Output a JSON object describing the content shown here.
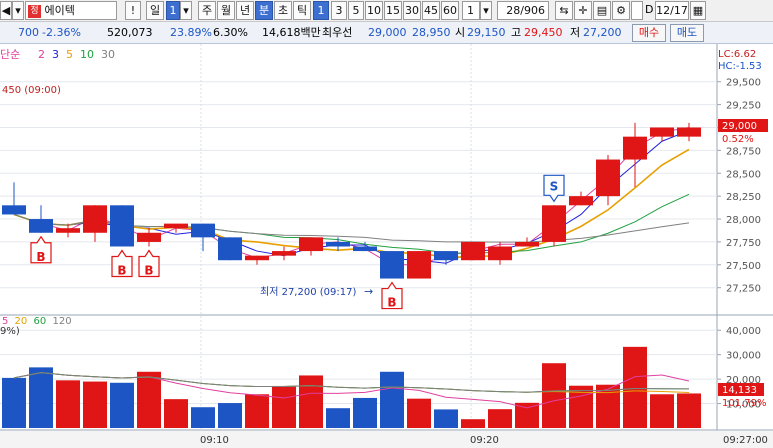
{
  "toolbar": {
    "stock_name": "에이텍",
    "period_buttons": [
      "일",
      "주",
      "월",
      "년",
      "분",
      "초",
      "틱"
    ],
    "active_period": "분",
    "interval_buttons": [
      "1",
      "3",
      "5",
      "10",
      "15",
      "30",
      "45",
      "60"
    ],
    "active_interval": "1",
    "count_value": "1",
    "page_counter": "28/906",
    "checkbox_label": "D",
    "date_value": "12/17"
  },
  "quote": {
    "change": "700",
    "change_pct": "-2.36%",
    "volume": "520,073",
    "turnover_pct": "23.89%",
    "ratio_pct": "6.30%",
    "trade_value": "14,618백만",
    "best_ask_label": "최우선",
    "best_ask": "29,000",
    "best_bid": "28,950",
    "open_label": "시",
    "open": "29,150",
    "high_label": "고",
    "high": "29,450",
    "low_label": "저",
    "low": "27,200",
    "buy_button": "매수",
    "sell_button": "매도"
  },
  "chart_data": {
    "type": "candlestick",
    "ma_legend": {
      "label": "단순",
      "periods": [
        "2",
        "3",
        "5",
        "10",
        "30"
      ],
      "colors": [
        "#e040a0",
        "#2020e0",
        "#e8a000",
        "#20a040",
        "#808080"
      ]
    },
    "volume_ma_legend": {
      "periods": [
        "5",
        "20",
        "60",
        "120"
      ],
      "colors": [
        "#e040a0",
        "#e8a000",
        "#20a040",
        "#808080"
      ]
    },
    "price_axis_ticks": [
      "29,500",
      "29,250",
      "29,000",
      "28,750",
      "28,500",
      "28,250",
      "28,000",
      "27,750",
      "27,500",
      "27,250"
    ],
    "price_range": [
      27050,
      29650
    ],
    "volume_axis_ticks": [
      "40,000",
      "30,000",
      "20,000",
      "10,000"
    ],
    "volume_range": [
      0,
      45000
    ],
    "time_labels": [
      "09:10",
      "09:20",
      "09:27:00"
    ],
    "candles": [
      {
        "o": 28150,
        "h": 28400,
        "l": 28050,
        "c": 28050,
        "v": 20500
      },
      {
        "o": 28000,
        "h": 28150,
        "l": 27850,
        "c": 27850,
        "v": 24800
      },
      {
        "o": 27850,
        "h": 27950,
        "l": 27800,
        "c": 27900,
        "v": 19500
      },
      {
        "o": 27850,
        "h": 28150,
        "l": 27750,
        "c": 28150,
        "v": 19000
      },
      {
        "o": 28150,
        "h": 28150,
        "l": 27700,
        "c": 27700,
        "v": 18500
      },
      {
        "o": 27750,
        "h": 27900,
        "l": 27700,
        "c": 27850,
        "v": 23000
      },
      {
        "o": 27900,
        "h": 27950,
        "l": 27850,
        "c": 27950,
        "v": 11800
      },
      {
        "o": 27950,
        "h": 27950,
        "l": 27650,
        "c": 27800,
        "v": 8500
      },
      {
        "o": 27800,
        "h": 27800,
        "l": 27550,
        "c": 27550,
        "v": 10200
      },
      {
        "o": 27550,
        "h": 27600,
        "l": 27500,
        "c": 27600,
        "v": 13800
      },
      {
        "o": 27600,
        "h": 27700,
        "l": 27550,
        "c": 27650,
        "v": 17200
      },
      {
        "o": 27650,
        "h": 27800,
        "l": 27600,
        "c": 27800,
        "v": 21500
      },
      {
        "o": 27750,
        "h": 27800,
        "l": 27650,
        "c": 27700,
        "v": 8100
      },
      {
        "o": 27700,
        "h": 27750,
        "l": 27650,
        "c": 27650,
        "v": 12300
      },
      {
        "o": 27650,
        "h": 27650,
        "l": 27350,
        "c": 27350,
        "v": 23000
      },
      {
        "o": 27350,
        "h": 27650,
        "l": 27350,
        "c": 27650,
        "v": 12000
      },
      {
        "o": 27650,
        "h": 27650,
        "l": 27500,
        "c": 27550,
        "v": 7600
      },
      {
        "o": 27550,
        "h": 27750,
        "l": 27550,
        "c": 27750,
        "v": 3600
      },
      {
        "o": 27550,
        "h": 27750,
        "l": 27500,
        "c": 27700,
        "v": 7700
      },
      {
        "o": 27700,
        "h": 27800,
        "l": 27700,
        "c": 27750,
        "v": 10300
      },
      {
        "o": 27750,
        "h": 28150,
        "l": 27700,
        "c": 28150,
        "v": 26500
      },
      {
        "o": 28150,
        "h": 28300,
        "l": 28150,
        "c": 28250,
        "v": 17300
      },
      {
        "o": 28250,
        "h": 28700,
        "l": 28150,
        "c": 28650,
        "v": 17700
      },
      {
        "o": 28650,
        "h": 29050,
        "l": 28350,
        "c": 28900,
        "v": 33200
      },
      {
        "o": 28900,
        "h": 29000,
        "l": 28850,
        "c": 29000,
        "v": 13800
      },
      {
        "o": 28900,
        "h": 29050,
        "l": 28850,
        "c": 29000,
        "v": 14133
      }
    ],
    "markers": [
      {
        "index": 1,
        "label": "B"
      },
      {
        "index": 4,
        "label": "B"
      },
      {
        "index": 5,
        "label": "B"
      },
      {
        "index": 14,
        "label": "B"
      },
      {
        "index": 20,
        "label": "S"
      }
    ],
    "low_annotation": "최저 27,200 (09:17)",
    "ma_annotation": "450 (09:00)",
    "current_price_label": "29,000",
    "current_change_label": "0.52%",
    "current_volume_label": "14,133",
    "volume_ratio_label": "101.79%",
    "corner_label": "9%)",
    "lc_label": "LC:6.62",
    "hc_label": "HC:-1.53"
  }
}
